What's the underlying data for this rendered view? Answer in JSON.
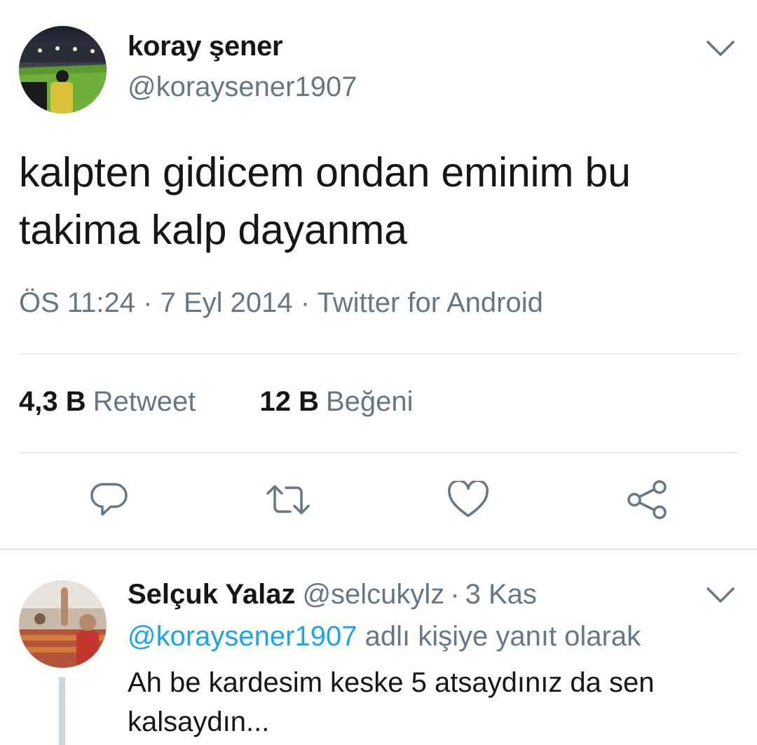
{
  "main_tweet": {
    "author_name": "koray şener",
    "author_handle": "@koraysener1907",
    "text": "kalpten gidicem ondan eminim bu takima kalp dayanma",
    "time": "ÖS 11:24",
    "date": "7 Eyl 2014",
    "source": "Twitter for Android",
    "meta_separator": "·",
    "stats": [
      {
        "count": "4,3 B",
        "label": "Retweet"
      },
      {
        "count": "12 B",
        "label": "Beğeni"
      }
    ],
    "actions": {
      "reply_icon": "reply-icon",
      "retweet_icon": "retweet-icon",
      "like_icon": "heart-icon",
      "share_icon": "share-icon"
    }
  },
  "reply_tweet": {
    "author_name": "Selçuk Yalaz",
    "author_handle": "@selcukylz",
    "separator": "·",
    "time": "3 Kas",
    "reply_to_mention": "@koraysener1907",
    "reply_to_suffix": "adlı kişiye yanıt olarak",
    "text": "Ah be kardesim keske 5 atsaydınız da sen kalsaydın..."
  },
  "colors": {
    "text_primary": "#14171a",
    "text_secondary": "#657786",
    "link": "#1da1f2",
    "divider": "#e6ecf0"
  }
}
